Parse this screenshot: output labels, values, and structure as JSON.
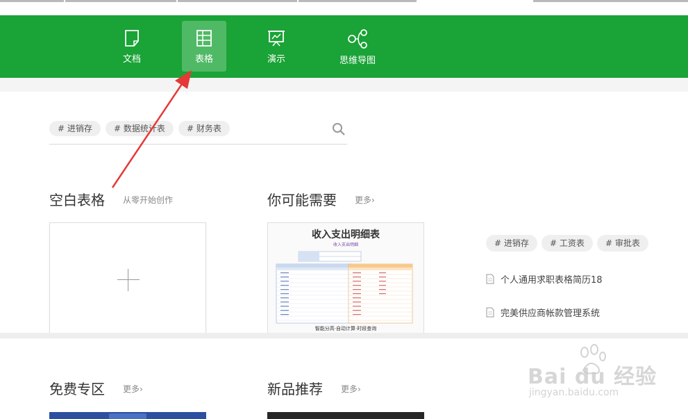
{
  "nav": {
    "tabs": [
      {
        "label": "文档",
        "icon": "document-icon"
      },
      {
        "label": "表格",
        "icon": "table-icon"
      },
      {
        "label": "演示",
        "icon": "presentation-icon"
      },
      {
        "label": "思维导图",
        "icon": "mindmap-icon"
      }
    ],
    "active_tab": "表格",
    "bar_color": "#1aa336"
  },
  "search": {
    "tags": [
      "# 进销存",
      "# 数据统计表",
      "# 财务表"
    ]
  },
  "blank_section": {
    "title": "空白表格",
    "subtitle": "从零开始创作"
  },
  "recommend_section": {
    "title": "你可能需要",
    "more": "更多›",
    "template": {
      "title": "收入支出明细表",
      "subtitle": "收入支出明细",
      "footer": "智能分高·自动计算·时段查询"
    },
    "tags": [
      "# 进销存",
      "# 工资表",
      "# 审批表"
    ],
    "docs": [
      "个人通用求职表格简历18",
      "完美供应商帐款管理系统"
    ]
  },
  "free_section": {
    "title": "免费专区",
    "more": "更多›"
  },
  "new_section": {
    "title": "新品推荐",
    "more": "更多›"
  },
  "watermark": {
    "logo": "Bai du 经验",
    "url": "jingyan.baidu.com"
  },
  "annotation_color": "#e53935"
}
